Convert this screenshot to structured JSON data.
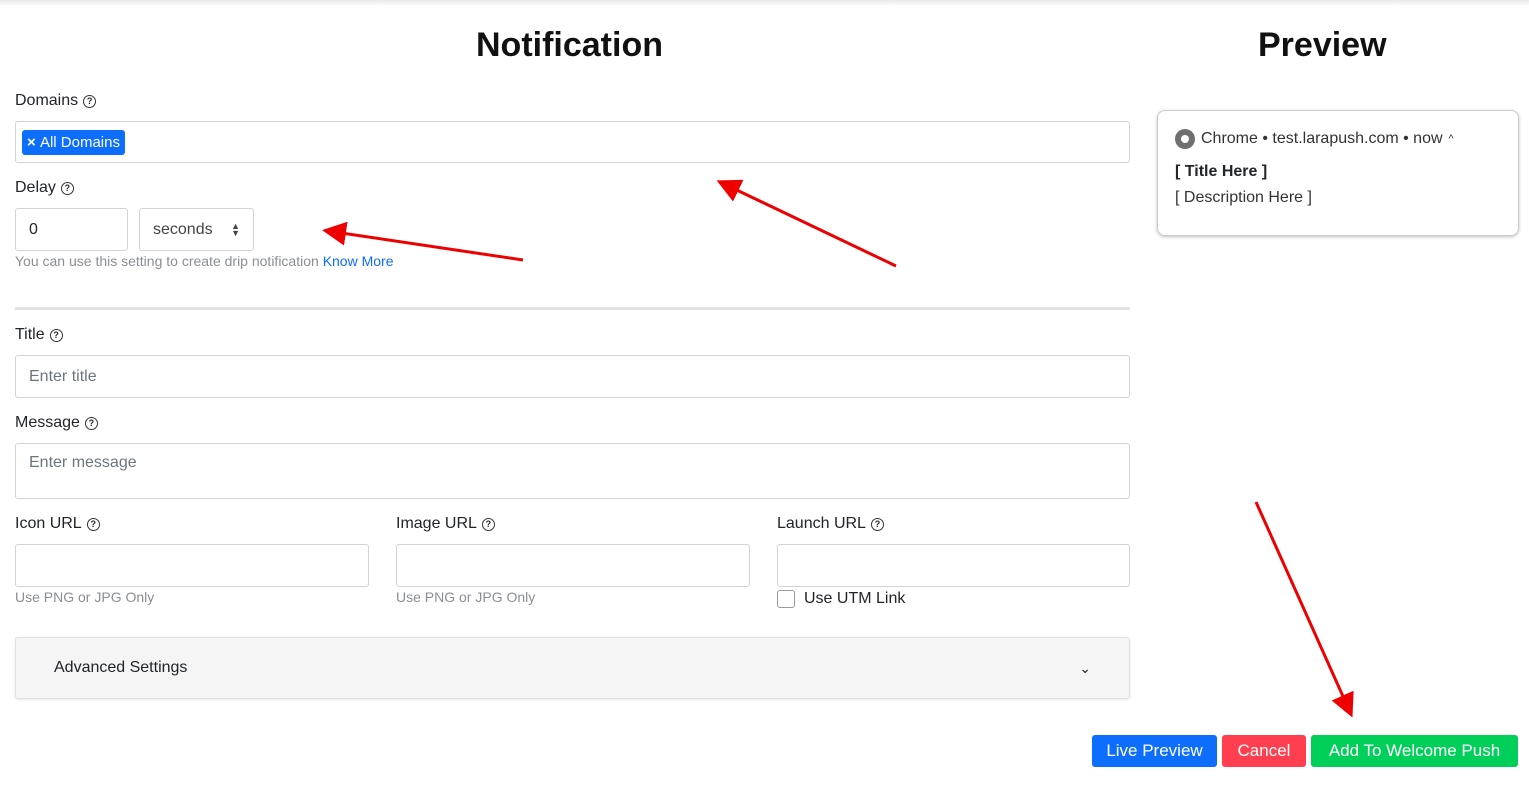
{
  "form": {
    "heading": "Notification",
    "domains": {
      "label": "Domains",
      "tag": "All Domains"
    },
    "delay": {
      "label": "Delay",
      "value": "0",
      "unit": "seconds",
      "help": "You can use this setting to create drip notification",
      "link": "Know More"
    },
    "title": {
      "label": "Title",
      "placeholder": "Enter title"
    },
    "message": {
      "label": "Message",
      "placeholder": "Enter message"
    },
    "icon_url": {
      "label": "Icon URL",
      "help": "Use PNG or JPG Only"
    },
    "image_url": {
      "label": "Image URL",
      "help": "Use PNG or JPG Only"
    },
    "launch_url": {
      "label": "Launch URL",
      "utm": "Use UTM Link"
    },
    "advanced": "Advanced Settings"
  },
  "preview": {
    "heading": "Preview",
    "source": "Chrome • test.larapush.com • now",
    "title": "[ Title Here ]",
    "description": "[ Description Here ]"
  },
  "actions": {
    "live_preview": "Live Preview",
    "cancel": "Cancel",
    "add": "Add To Welcome Push"
  },
  "colors": {
    "primary": "#0d6efd",
    "danger": "#ff3f4f",
    "success": "#00cf5a",
    "annotation": "#ee0000"
  }
}
